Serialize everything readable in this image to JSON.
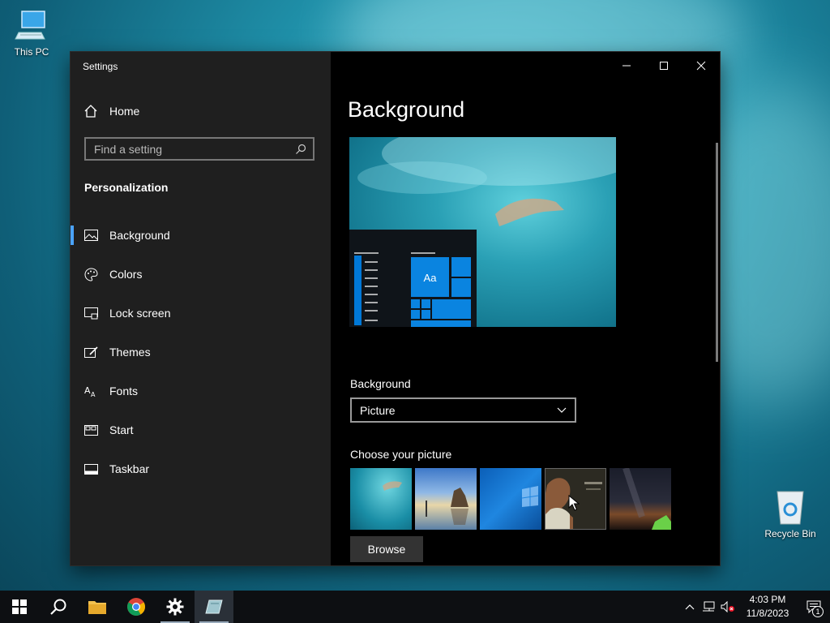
{
  "desktop": {
    "icons": [
      {
        "label": "This PC"
      },
      {
        "label": "Recycle Bin"
      }
    ]
  },
  "window": {
    "app_title": "Settings",
    "controls": {
      "minimize": "minimize",
      "maximize": "maximize",
      "close": "close"
    }
  },
  "sidebar": {
    "home_label": "Home",
    "search_placeholder": "Find a setting",
    "section_title": "Personalization",
    "items": [
      {
        "label": "Background",
        "icon": "picture-icon",
        "active": true
      },
      {
        "label": "Colors",
        "icon": "palette-icon"
      },
      {
        "label": "Lock screen",
        "icon": "monitor-icon"
      },
      {
        "label": "Themes",
        "icon": "brush-icon"
      },
      {
        "label": "Fonts",
        "icon": "font-icon"
      },
      {
        "label": "Start",
        "icon": "start-icon"
      },
      {
        "label": "Taskbar",
        "icon": "taskbar-icon"
      }
    ]
  },
  "main": {
    "page_title": "Background",
    "preview_tile_text": "Aa",
    "background_label": "Background",
    "background_value": "Picture",
    "choose_label": "Choose your picture",
    "browse_label": "Browse"
  },
  "taskbar": {
    "apps": [
      "start",
      "search",
      "file-explorer",
      "chrome",
      "settings",
      "active-app"
    ],
    "time": "4:03 PM",
    "date": "11/8/2023",
    "notification_count": "1"
  },
  "colors": {
    "accent": "#0078d7",
    "active_indicator": "#4aa3ff"
  }
}
